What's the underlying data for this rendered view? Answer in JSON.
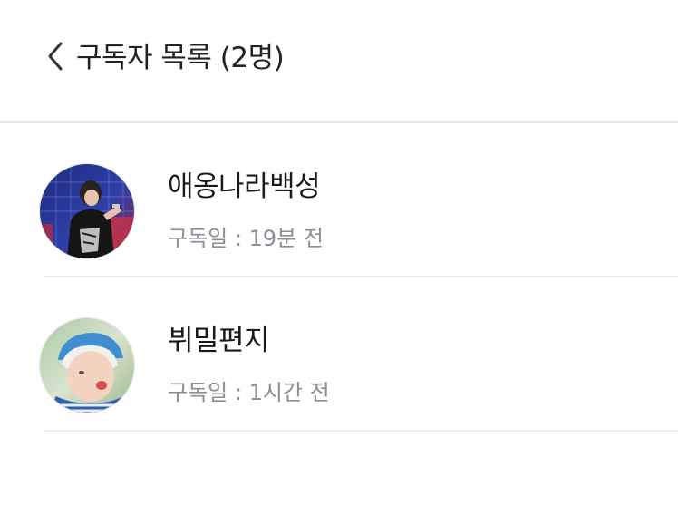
{
  "header": {
    "title": "구독자 목록 (2명)",
    "back_icon": "chevron-left-icon"
  },
  "subscribers": [
    {
      "nickname": "애옹나라백성",
      "subscribed": "구독일 : 19분 전",
      "avatar": "user-avatar-photo"
    },
    {
      "nickname": "뷔밀편지",
      "subscribed": "구독일 : 1시간 전",
      "avatar": "user-avatar-photo"
    }
  ],
  "colors": {
    "title_text": "#222222",
    "name_text": "#1a1a1a",
    "meta_text": "#8a8f96",
    "divider": "#ebebeb"
  }
}
